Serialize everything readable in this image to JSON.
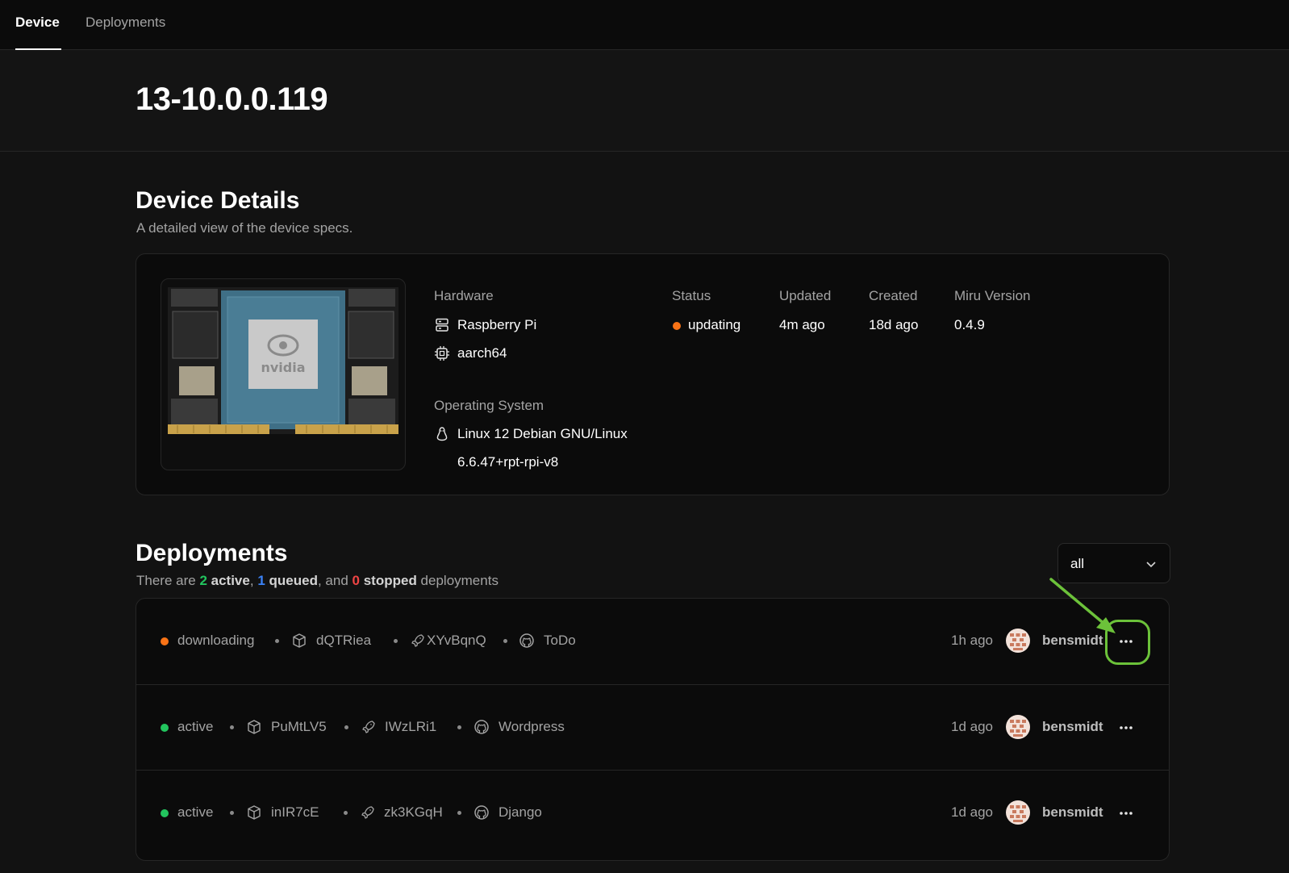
{
  "nav": {
    "tabs": [
      {
        "label": "Device",
        "active": true
      },
      {
        "label": "Deployments",
        "active": false
      }
    ]
  },
  "device": {
    "name": "13-10.0.0.119"
  },
  "details": {
    "title": "Device Details",
    "subtitle": "A detailed view of the device specs.",
    "image_text": "nvidia",
    "hardware": {
      "label": "Hardware",
      "model": "Raspberry Pi",
      "arch": "aarch64",
      "model_icon": "server-icon",
      "arch_icon": "cpu-icon"
    },
    "os": {
      "label": "Operating System",
      "name": "Linux 12 Debian GNU/Linux",
      "kernel": "6.6.47+rpt-rpi-v8",
      "icon": "linux-icon"
    },
    "status": {
      "label": "Status",
      "value": "updating",
      "color": "#f97316"
    },
    "updated": {
      "label": "Updated",
      "value": "4m ago"
    },
    "created": {
      "label": "Created",
      "value": "18d ago"
    },
    "miru": {
      "label": "Miru Version",
      "value": "0.4.9"
    }
  },
  "deployments": {
    "title": "Deployments",
    "summary": {
      "prefix": "There are ",
      "active_count": "2",
      "active_label": "active",
      "comma": ",",
      "queued_count": "1",
      "queued_label": "queued",
      "and": ", and ",
      "stopped_count": "0",
      "stopped_label": "stopped",
      "suffix": " deployments"
    },
    "filter": {
      "value": "all"
    },
    "rows": [
      {
        "status": "downloading",
        "status_color": "#f97316",
        "package": "dQTRiea",
        "release": "XYvBqnQ",
        "repo": "ToDo",
        "time": "1h ago",
        "user": "bensmidt"
      },
      {
        "status": "active",
        "status_color": "#22c55e",
        "package": "PuMtLV5",
        "release": "IWzLRi1",
        "repo": "Wordpress",
        "time": "1d ago",
        "user": "bensmidt"
      },
      {
        "status": "active",
        "status_color": "#22c55e",
        "package": "inIR7cE",
        "release": "zk3KGqH",
        "repo": "Django",
        "time": "1d ago",
        "user": "bensmidt"
      }
    ]
  },
  "colors": {
    "active": "#22c55e",
    "queued": "#3b82f6",
    "stopped": "#ef4444",
    "annotation": "#6cc23a"
  }
}
